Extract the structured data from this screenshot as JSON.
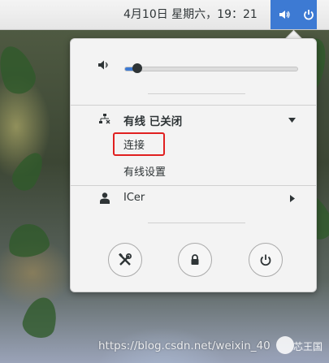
{
  "topbar": {
    "clock": "4月10日 星期六，19：21",
    "indicators": [
      "volume-icon",
      "power-icon"
    ],
    "accent_color": "#3d7ad3"
  },
  "menu": {
    "volume": {
      "icon": "speaker-muted-icon",
      "level": 0.07
    },
    "network": {
      "icon": "wired-network-icon",
      "title": "有线  已关闭",
      "expand_icon": "triangle-down-icon",
      "items": [
        "连接",
        "有线设置"
      ]
    },
    "user": {
      "icon": "user-icon",
      "name": "ICer",
      "expand_icon": "triangle-right-icon"
    },
    "actions": [
      "settings-icon",
      "lock-icon",
      "power-off-icon"
    ],
    "highlight_color": "#e02020"
  },
  "watermark": {
    "url": "https://blog.csdn.net/weixin_40",
    "wechat_name": "芯王国"
  }
}
